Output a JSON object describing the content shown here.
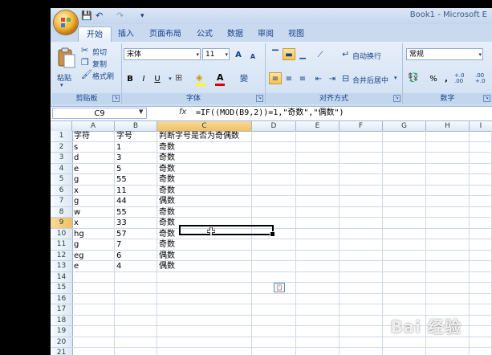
{
  "window": {
    "title": "Book1 - Microsoft E"
  },
  "quick_access": {
    "save": "💾",
    "undo": "↶",
    "redo": "↷",
    "more": "▾"
  },
  "tabs": [
    {
      "label": "开始",
      "active": true
    },
    {
      "label": "插入"
    },
    {
      "label": "页面布局"
    },
    {
      "label": "公式"
    },
    {
      "label": "数据"
    },
    {
      "label": "审阅"
    },
    {
      "label": "视图"
    }
  ],
  "ribbon": {
    "clipboard": {
      "label": "剪贴板",
      "paste": "粘贴",
      "cut": "剪切",
      "copy": "复制",
      "format_painter": "格式刷"
    },
    "font": {
      "label": "字体",
      "name": "宋体",
      "size": "11",
      "bold": "B",
      "italic": "I",
      "underline": "U",
      "grow": "A",
      "shrink": "A",
      "wen": "變"
    },
    "alignment": {
      "label": "对齐方式",
      "wrap": "自动换行",
      "merge": "合并后居中"
    },
    "number": {
      "label": "数字",
      "format": "常规",
      "percent": "%",
      "comma": ",",
      "inc_dec": "+.0 .00",
      "dec_dec": ".00 +.0"
    }
  },
  "formula_bar": {
    "name_box": "C9",
    "fx": "fx",
    "formula": "=IF((MOD(B9,2))=1,\"奇数\",\"偶数\")"
  },
  "grid": {
    "columns": [
      "A",
      "B",
      "C",
      "D",
      "E",
      "F",
      "G",
      "H",
      "I"
    ],
    "rows": [
      "1",
      "2",
      "3",
      "4",
      "5",
      "6",
      "7",
      "8",
      "9",
      "10",
      "11",
      "12",
      "13",
      "14",
      "15",
      "16",
      "17",
      "18",
      "19",
      "20",
      "21"
    ],
    "data": [
      [
        "字符",
        "字号",
        "判断字号是否为奇偶数"
      ],
      [
        "s",
        "1",
        "奇数"
      ],
      [
        "d",
        "3",
        "奇数"
      ],
      [
        "e",
        "5",
        "奇数"
      ],
      [
        "g",
        "55",
        "奇数"
      ],
      [
        "x",
        "11",
        "奇数"
      ],
      [
        "g",
        "44",
        "偶数"
      ],
      [
        "w",
        "55",
        "奇数"
      ],
      [
        "x",
        "33",
        "奇数"
      ],
      [
        "hg",
        "57",
        "奇数"
      ],
      [
        "g",
        "7",
        "奇数"
      ],
      [
        "eg",
        "6",
        "偶数"
      ],
      [
        "e",
        "4",
        "偶数"
      ]
    ]
  },
  "watermark": "Bai 经验"
}
